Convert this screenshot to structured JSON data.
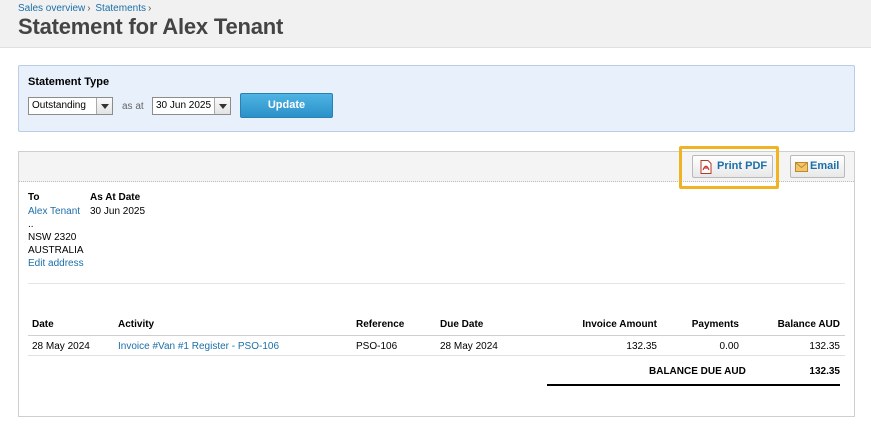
{
  "breadcrumb": {
    "items": [
      "Sales overview",
      "Statements"
    ],
    "separator": "›"
  },
  "page_title": "Statement for Alex Tenant",
  "statement_type": {
    "label": "Statement Type",
    "type_value": "Outstanding",
    "as_at_label": "as at",
    "date_value": "30 Jun 2025",
    "update_label": "Update"
  },
  "toolbar": {
    "print_label": "Print PDF",
    "email_label": "Email",
    "print_icon": "pdf-icon",
    "email_icon": "envelope-icon",
    "highlight_color": "#f0b323"
  },
  "recipient": {
    "to_label": "To",
    "name": "Alex Tenant",
    "line1": "..",
    "line2": "NSW 2320",
    "line3": "AUSTRALIA",
    "edit_label": "Edit address",
    "as_at_label": "As At Date",
    "as_at_value": "30 Jun 2025"
  },
  "table": {
    "headers": [
      "Date",
      "Activity",
      "Reference",
      "Due Date",
      "Invoice Amount",
      "Payments",
      "Balance AUD"
    ],
    "rows": [
      [
        "28 May 2024",
        "Invoice #Van #1 Register - PSO-106",
        "PSO-106",
        "28 May 2024",
        "132.35",
        "0.00",
        "132.35"
      ]
    ],
    "balance_label": "BALANCE DUE AUD",
    "balance_value": "132.35"
  },
  "colors": {
    "link": "#1b6fa8",
    "update_button": "#2a91c9",
    "panel_bg": "#e8f0fb"
  }
}
